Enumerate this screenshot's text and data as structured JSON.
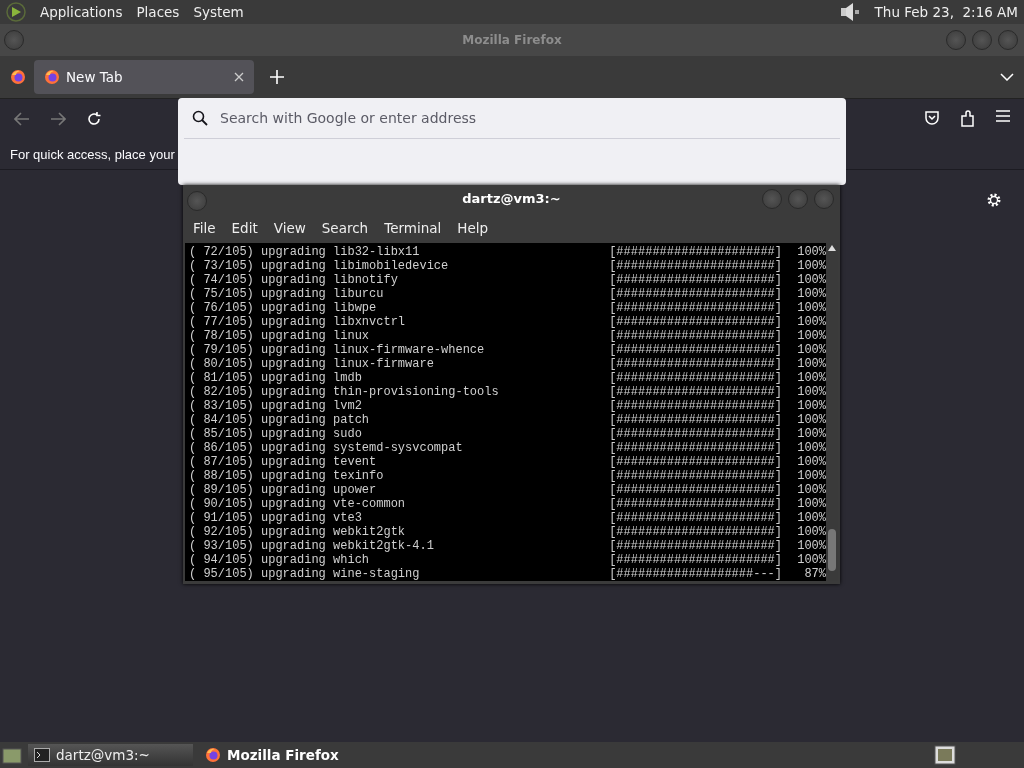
{
  "top_panel": {
    "menus": [
      "Applications",
      "Places",
      "System"
    ],
    "clock": "Thu Feb 23,  2:16 AM"
  },
  "firefox": {
    "title": "Mozilla Firefox",
    "tabs": [
      {
        "label": "New Tab",
        "selected": true
      }
    ],
    "bookmarks_hint": "For quick access, place your",
    "address_popup": {
      "placeholder": "Search with Google or enter address"
    }
  },
  "terminal": {
    "title": "dartz@vm3:~",
    "menus": [
      "File",
      "Edit",
      "View",
      "Search",
      "Terminal",
      "Help"
    ],
    "lines": [
      {
        "text": "( 72/105) upgrading lib32-libx11",
        "bar": "[######################]",
        "percent": "100%"
      },
      {
        "text": "( 73/105) upgrading libimobiledevice",
        "bar": "[######################]",
        "percent": "100%"
      },
      {
        "text": "( 74/105) upgrading libnotify",
        "bar": "[######################]",
        "percent": "100%"
      },
      {
        "text": "( 75/105) upgrading liburcu",
        "bar": "[######################]",
        "percent": "100%"
      },
      {
        "text": "( 76/105) upgrading libwpe",
        "bar": "[######################]",
        "percent": "100%"
      },
      {
        "text": "( 77/105) upgrading libxnvctrl",
        "bar": "[######################]",
        "percent": "100%"
      },
      {
        "text": "( 78/105) upgrading linux",
        "bar": "[######################]",
        "percent": "100%"
      },
      {
        "text": "( 79/105) upgrading linux-firmware-whence",
        "bar": "[######################]",
        "percent": "100%"
      },
      {
        "text": "( 80/105) upgrading linux-firmware",
        "bar": "[######################]",
        "percent": "100%"
      },
      {
        "text": "( 81/105) upgrading lmdb",
        "bar": "[######################]",
        "percent": "100%"
      },
      {
        "text": "( 82/105) upgrading thin-provisioning-tools",
        "bar": "[######################]",
        "percent": "100%"
      },
      {
        "text": "( 83/105) upgrading lvm2",
        "bar": "[######################]",
        "percent": "100%"
      },
      {
        "text": "( 84/105) upgrading patch",
        "bar": "[######################]",
        "percent": "100%"
      },
      {
        "text": "( 85/105) upgrading sudo",
        "bar": "[######################]",
        "percent": "100%"
      },
      {
        "text": "( 86/105) upgrading systemd-sysvcompat",
        "bar": "[######################]",
        "percent": "100%"
      },
      {
        "text": "( 87/105) upgrading tevent",
        "bar": "[######################]",
        "percent": "100%"
      },
      {
        "text": "( 88/105) upgrading texinfo",
        "bar": "[######################]",
        "percent": "100%"
      },
      {
        "text": "( 89/105) upgrading upower",
        "bar": "[######################]",
        "percent": "100%"
      },
      {
        "text": "( 90/105) upgrading vte-common",
        "bar": "[######################]",
        "percent": "100%"
      },
      {
        "text": "( 91/105) upgrading vte3",
        "bar": "[######################]",
        "percent": "100%"
      },
      {
        "text": "( 92/105) upgrading webkit2gtk",
        "bar": "[######################]",
        "percent": "100%"
      },
      {
        "text": "( 93/105) upgrading webkit2gtk-4.1",
        "bar": "[######################]",
        "percent": "100%"
      },
      {
        "text": "( 94/105) upgrading which",
        "bar": "[######################]",
        "percent": "100%"
      },
      {
        "text": "( 95/105) upgrading wine-staging",
        "bar": "[###################---]",
        "percent": "87%"
      }
    ]
  },
  "taskbar": {
    "tasks": [
      {
        "label": "dartz@vm3:~",
        "selected": false
      },
      {
        "label": "Mozilla Firefox",
        "selected": true
      }
    ]
  }
}
